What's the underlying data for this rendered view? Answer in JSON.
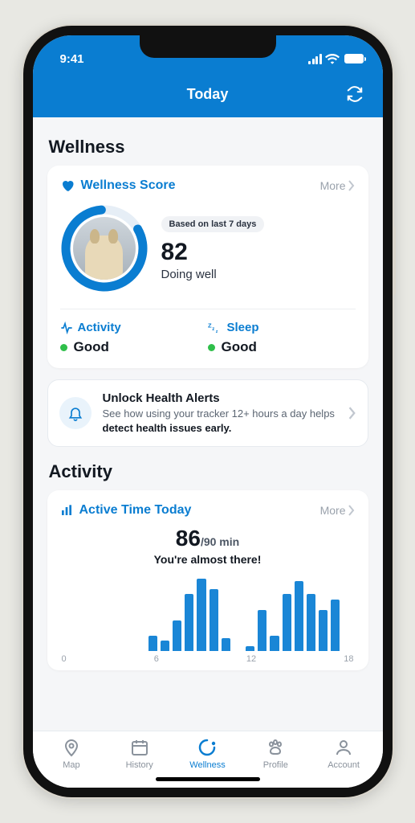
{
  "statusbar": {
    "time": "9:41"
  },
  "header": {
    "title": "Today"
  },
  "sections": {
    "wellness": "Wellness",
    "activity": "Activity"
  },
  "wellness_card": {
    "title": "Wellness Score",
    "more": "More",
    "pill": "Based on last 7 days",
    "score": "82",
    "caption": "Doing well",
    "activity_label": "Activity",
    "activity_value": "Good",
    "sleep_label": "Sleep",
    "sleep_value": "Good"
  },
  "banner": {
    "title": "Unlock Health Alerts",
    "body_pre": "See how using your tracker 12+ hours a day helps ",
    "body_bold": "detect health issues early."
  },
  "activity_card": {
    "title": "Active Time Today",
    "more": "More",
    "value": "86",
    "goal": "/90 min",
    "caption": "You're almost there!"
  },
  "chart_data": {
    "type": "bar",
    "xlabel": "",
    "ylabel": "",
    "categories": [
      0,
      1,
      2,
      3,
      4,
      5,
      6,
      7,
      8,
      9,
      10,
      11,
      12,
      13,
      14,
      15,
      16,
      17,
      18,
      19,
      20,
      21,
      22,
      23
    ],
    "values": [
      0,
      0,
      0,
      0,
      0,
      0,
      0,
      6,
      4,
      12,
      22,
      28,
      24,
      5,
      0,
      2,
      16,
      6,
      22,
      27,
      22,
      16,
      20,
      0
    ],
    "ticks": [
      "0",
      "6",
      "12",
      "18"
    ]
  },
  "tabs": {
    "map": "Map",
    "history": "History",
    "wellness": "Wellness",
    "profile": "Profile",
    "account": "Account"
  }
}
